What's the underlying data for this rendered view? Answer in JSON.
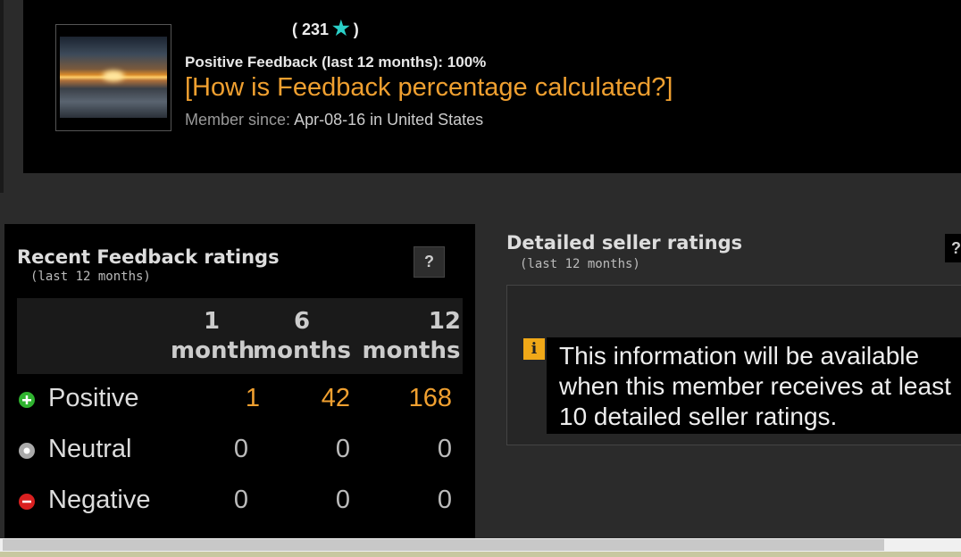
{
  "profile": {
    "username": "",
    "score": "( 231",
    "score_close": ")",
    "positive_feedback": "Positive Feedback (last 12 months): 100%",
    "how_link": "[How is Feedback percentage calculated?]",
    "member_since_label": "Member since:",
    "member_since_value": "Apr-08-16 in United States"
  },
  "recent": {
    "title": "Recent Feedback ratings",
    "subtitle": "(last 12 months)",
    "help": "?",
    "columns": [
      {
        "num": "1",
        "unit": "month"
      },
      {
        "num": "6",
        "unit": "months"
      },
      {
        "num": "12",
        "unit": "months"
      }
    ],
    "rows": [
      {
        "label": "Positive",
        "values": [
          "1",
          "42",
          "168"
        ],
        "icon": "plus-icon",
        "color": "#2fb32f"
      },
      {
        "label": "Neutral",
        "values": [
          "0",
          "0",
          "0"
        ],
        "icon": "dot-icon",
        "color": "#aaaaaa"
      },
      {
        "label": "Negative",
        "values": [
          "0",
          "0",
          "0"
        ],
        "icon": "minus-icon",
        "color": "#d92020"
      }
    ]
  },
  "detailed": {
    "title": "Detailed seller ratings",
    "subtitle": "(last 12 months)",
    "info_icon": "i",
    "info": "This information will be available when this member receives at least 10 detailed seller ratings.",
    "help": "?"
  },
  "colors": {
    "accent": "#f0a030",
    "star": "#2ad0c8"
  }
}
